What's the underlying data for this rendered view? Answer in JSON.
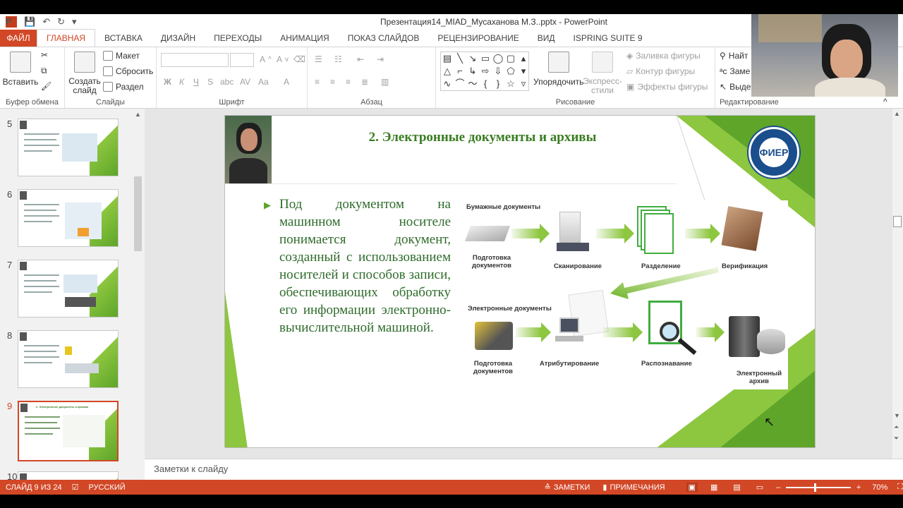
{
  "window": {
    "title": "Презентация14_MIAD_Мусаханова М.З..pptx - PowerPoint"
  },
  "quick_access": {
    "save": "💾",
    "undo": "↶",
    "redo": "↻",
    "customize": "▾"
  },
  "tabs": [
    "ФАЙЛ",
    "ГЛАВНАЯ",
    "ВСТАВКА",
    "ДИЗАЙН",
    "ПЕРЕХОДЫ",
    "АНИМАЦИЯ",
    "ПОКАЗ СЛАЙДОВ",
    "РЕЦЕНЗИРОВАНИЕ",
    "ВИД",
    "ISPRING SUITE 9"
  ],
  "ribbon": {
    "clipboard": {
      "label": "Буфер обмена",
      "paste": "Вставить"
    },
    "slides": {
      "label": "Слайды",
      "new_slide": "Создать слайд",
      "layout": "Макет",
      "reset": "Сбросить",
      "section": "Раздел"
    },
    "font": {
      "label": "Шрифт",
      "bold": "Ж",
      "italic": "К",
      "underline": "Ч",
      "strike": "S",
      "shadow": "abc",
      "spacing": "AV",
      "case": "Aa",
      "color": "A"
    },
    "paragraph": {
      "label": "Абзац"
    },
    "drawing": {
      "label": "Рисование",
      "arrange": "Упорядочить",
      "quick_styles": "Экспресс-стили",
      "fill": "Заливка фигуры",
      "outline": "Контур фигуры",
      "effects": "Эффекты фигуры"
    },
    "editing": {
      "label": "Редактирование",
      "find": "Найт",
      "replace": "Заме",
      "select": "Выде"
    }
  },
  "thumbnails": [
    {
      "num": "5"
    },
    {
      "num": "6"
    },
    {
      "num": "7"
    },
    {
      "num": "8"
    },
    {
      "num": "9",
      "title": "2. Электронные документы и архивы"
    },
    {
      "num": "10"
    }
  ],
  "slide": {
    "title": "2. Электронные документы и архивы",
    "bullet": "Под документом на машинном носителе понимается документ, созданный с использованием носителей и способов записи, обеспечивающих обработку его информации электронно-вычислительной машиной.",
    "logo_text": "ФИЕР",
    "diagram": {
      "paper_docs": "Бумажные документы",
      "prep1": "Подготовка документов",
      "scan": "Сканирование",
      "split": "Разделение",
      "verify": "Верификация",
      "e_docs": "Электронные документы",
      "prep2": "Подготовка документов",
      "attr": "Атрибутирование",
      "recog": "Распознавание",
      "archive": "Электронный архив"
    }
  },
  "notes": {
    "placeholder": "Заметки к слайду"
  },
  "status": {
    "slide_info": "СЛАЙД 9 ИЗ 24",
    "language": "РУССКИЙ",
    "notes": "ЗАМЕТКИ",
    "comments": "ПРИМЕЧАНИЯ",
    "zoom": "70%"
  },
  "colors": {
    "accent": "#d24726",
    "green": "#8dc63f",
    "title_green": "#3a7d22"
  }
}
